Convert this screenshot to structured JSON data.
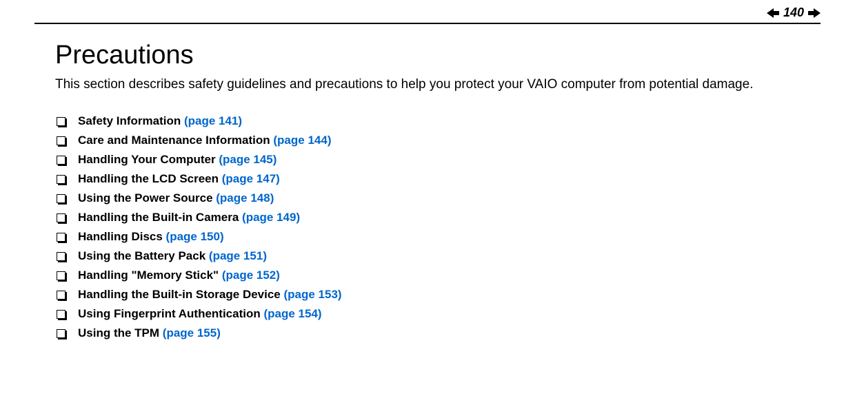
{
  "header": {
    "page_number": "140"
  },
  "title": "Precautions",
  "intro": "This section describes safety guidelines and precautions to help you protect your VAIO computer from potential damage.",
  "toc": [
    {
      "label": "Safety Information ",
      "page_link": "(page 141)"
    },
    {
      "label": "Care and Maintenance Information ",
      "page_link": "(page 144)"
    },
    {
      "label": "Handling Your Computer ",
      "page_link": "(page 145)"
    },
    {
      "label": "Handling the LCD Screen ",
      "page_link": "(page 147)"
    },
    {
      "label": "Using the Power Source ",
      "page_link": "(page 148)"
    },
    {
      "label": "Handling the Built-in Camera ",
      "page_link": "(page 149)"
    },
    {
      "label": "Handling Discs ",
      "page_link": "(page 150)"
    },
    {
      "label": "Using the Battery Pack ",
      "page_link": "(page 151)"
    },
    {
      "label": "Handling \"Memory Stick\" ",
      "page_link": "(page 152)"
    },
    {
      "label": "Handling the Built-in Storage Device ",
      "page_link": "(page 153)"
    },
    {
      "label": "Using Fingerprint Authentication ",
      "page_link": "(page 154)"
    },
    {
      "label": "Using the TPM ",
      "page_link": "(page 155)"
    }
  ]
}
